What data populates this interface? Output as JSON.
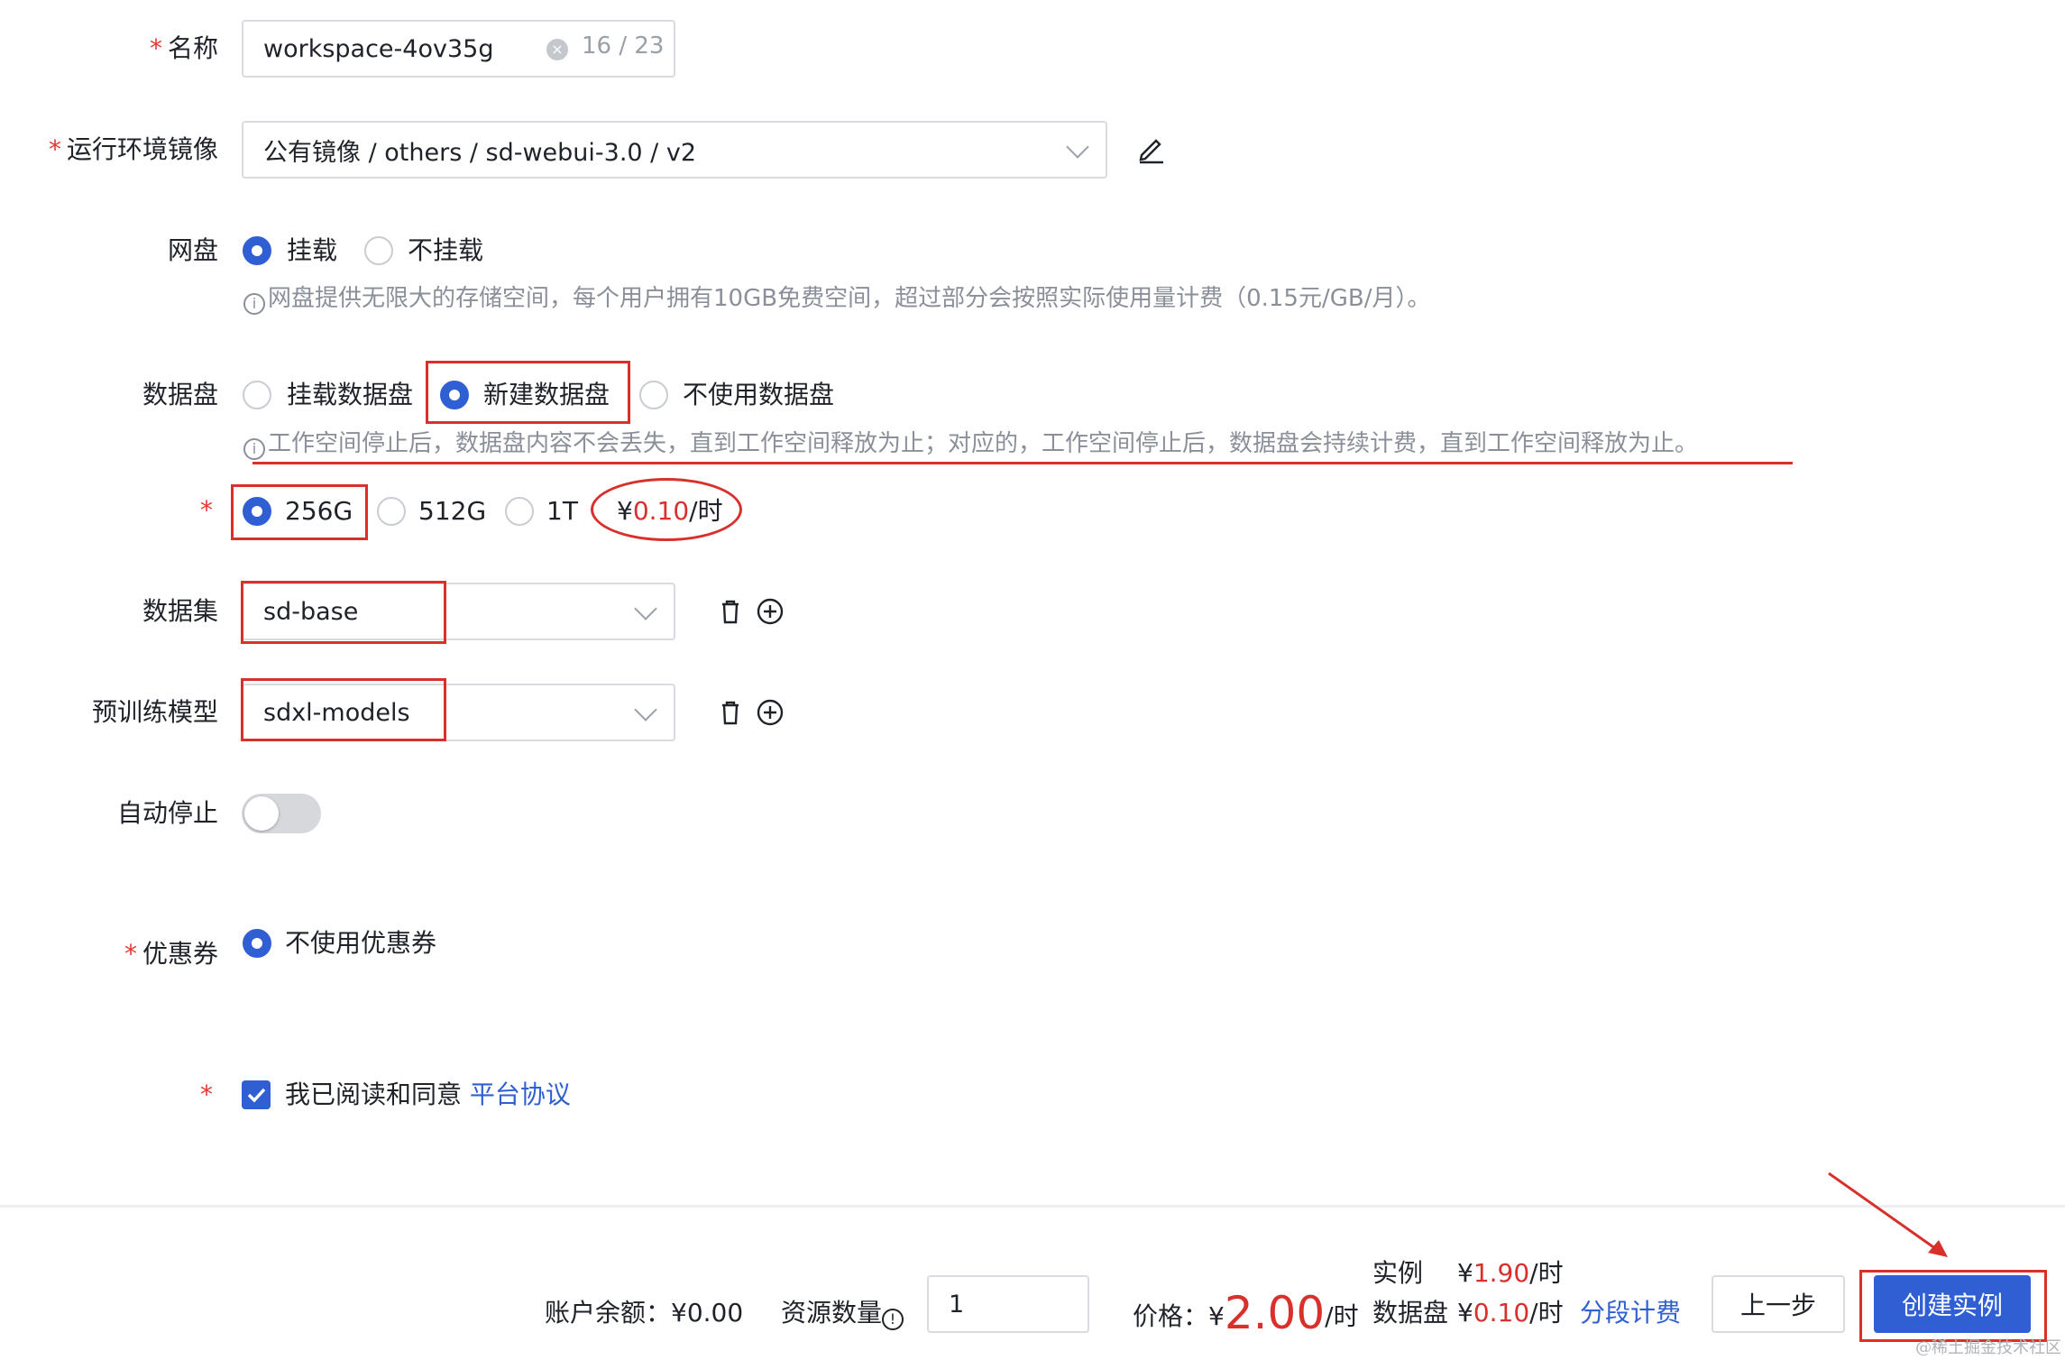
{
  "form": {
    "name": {
      "label": "名称",
      "value": "workspace-4ov35g",
      "counter": "16 / 23"
    },
    "image": {
      "label": "运行环境镜像",
      "value": "公有镜像 / others / sd-webui-3.0 / v2"
    },
    "netdisk": {
      "label": "网盘",
      "options": [
        "挂载",
        "不挂载"
      ],
      "selected": 0,
      "hint": "网盘提供无限大的存储空间，每个用户拥有10GB免费空间，超过部分会按照实际使用量计费（0.15元/GB/月）。"
    },
    "datadisk": {
      "label": "数据盘",
      "options": [
        "挂载数据盘",
        "新建数据盘",
        "不使用数据盘"
      ],
      "selected": 1,
      "hint": "工作空间停止后，数据盘内容不会丢失，直到工作空间释放为止；对应的，工作空间停止后，数据盘会持续计费，直到工作空间释放为止。"
    },
    "disksize": {
      "options": [
        "256G",
        "512G",
        "1T"
      ],
      "selected": 0,
      "price_prefix": "¥",
      "price": "0.10",
      "price_unit": "/时"
    },
    "dataset": {
      "label": "数据集",
      "value": "sd-base"
    },
    "model": {
      "label": "预训练模型",
      "value": "sdxl-models"
    },
    "autostop": {
      "label": "自动停止",
      "on": false
    },
    "coupon": {
      "label": "优惠券",
      "option": "不使用优惠券"
    },
    "agreement": {
      "text": "我已阅读和同意",
      "link": "平台协议",
      "checked": true
    }
  },
  "footer": {
    "balance": "账户余额：¥0.00",
    "quantity_label": "资源数量",
    "quantity": "1",
    "price_label": "价格：¥",
    "price": "2.00",
    "price_unit": "/时",
    "instance_label": "实例",
    "instance_prefix": "¥",
    "instance_price": "1.90",
    "instance_unit": "/时",
    "disk_label": "数据盘",
    "disk_prefix": "¥",
    "disk_price": "0.10",
    "disk_unit": "/时",
    "tiered_link": "分段计费",
    "prev_button": "上一步",
    "create_button": "创建实例"
  },
  "watermark": "@稀土掘金技术社区",
  "colors": {
    "primary": "#2f5fd3",
    "annotation_red": "#d9302c",
    "required": "#e53935"
  }
}
